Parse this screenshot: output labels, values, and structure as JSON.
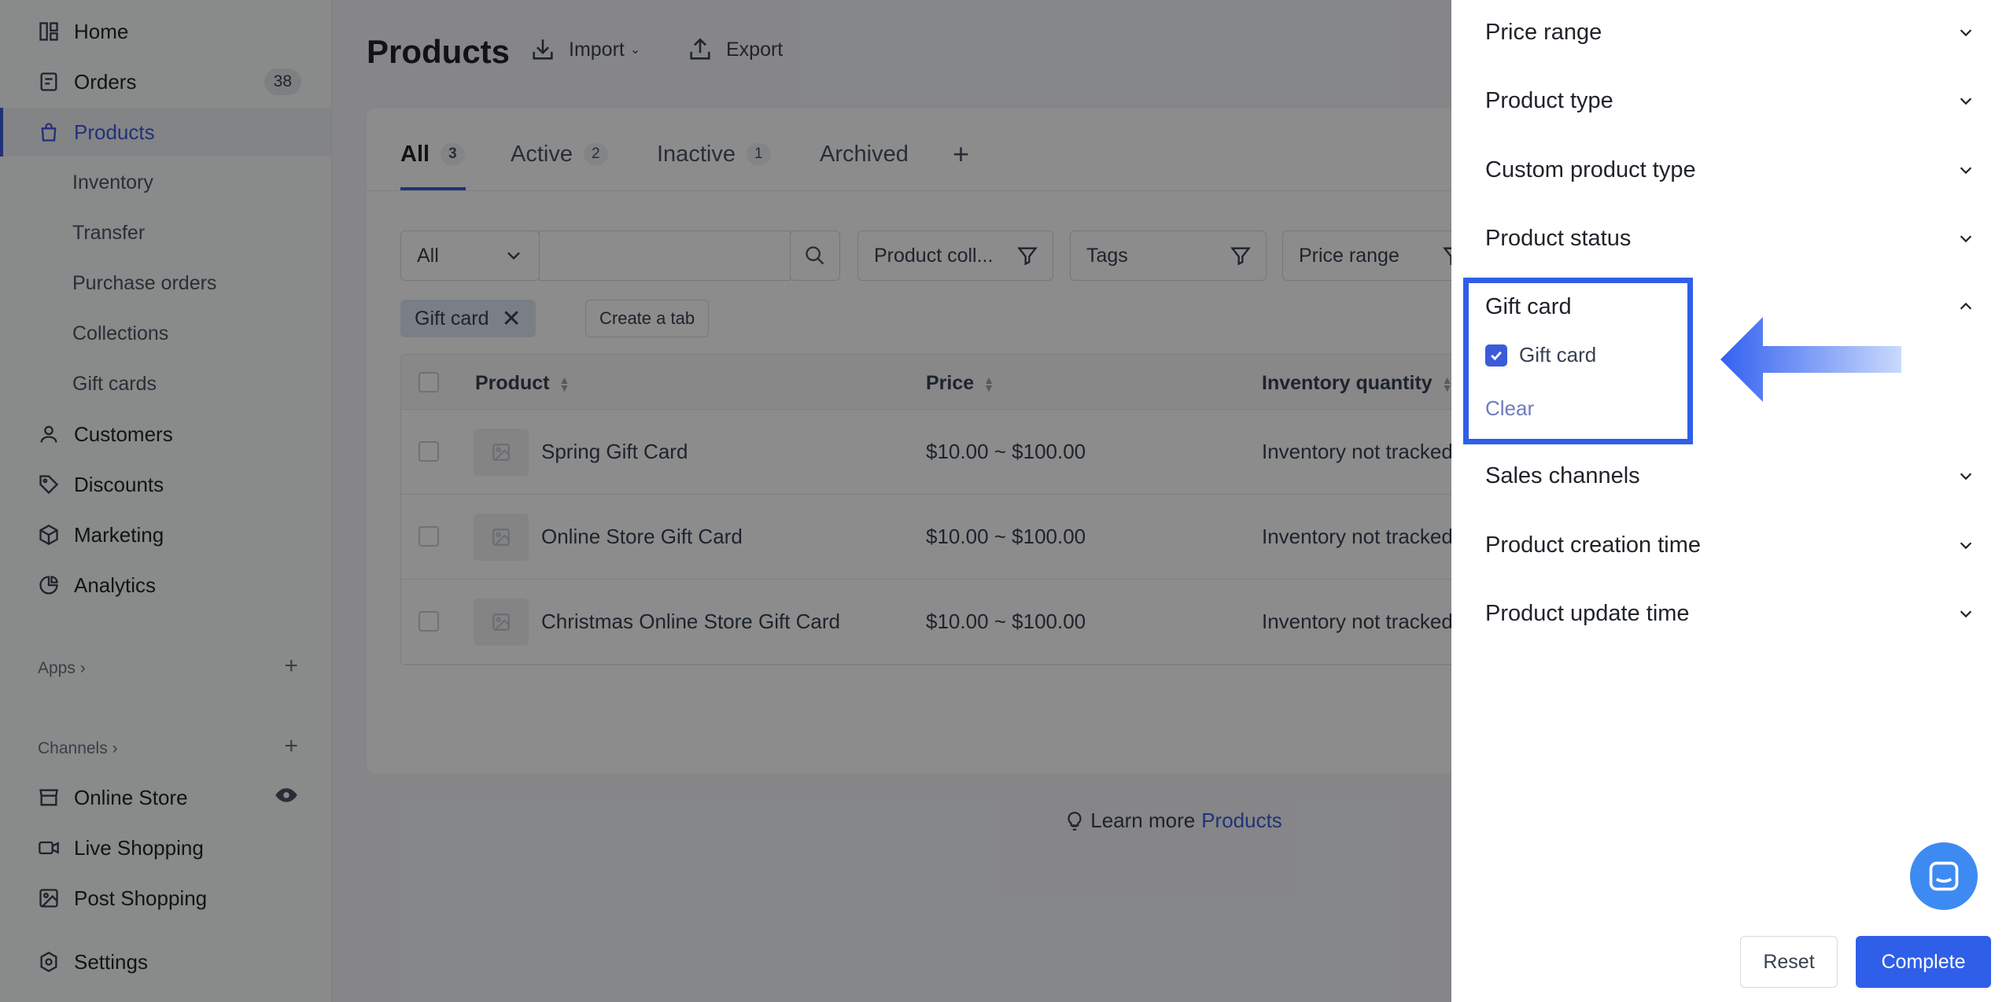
{
  "sidebar": {
    "items": [
      {
        "label": "Home",
        "icon": "home-icon"
      },
      {
        "label": "Orders",
        "icon": "orders-icon",
        "badge": "38"
      },
      {
        "label": "Products",
        "icon": "bag-icon",
        "active": true
      },
      {
        "label": "Customers",
        "icon": "person-icon"
      },
      {
        "label": "Discounts",
        "icon": "tag-icon"
      },
      {
        "label": "Marketing",
        "icon": "cube-icon"
      },
      {
        "label": "Analytics",
        "icon": "pie-icon"
      }
    ],
    "subitems": [
      "Inventory",
      "Transfer",
      "Purchase orders",
      "Collections",
      "Gift cards"
    ],
    "apps_label": "Apps",
    "channels_label": "Channels",
    "channels": [
      {
        "label": "Online Store",
        "icon": "store-icon"
      },
      {
        "label": "Live Shopping",
        "icon": "video-icon"
      },
      {
        "label": "Post Shopping",
        "icon": "image-icon"
      }
    ],
    "settings_label": "Settings"
  },
  "header": {
    "title": "Products",
    "import_label": "Import",
    "export_label": "Export"
  },
  "tabs": [
    {
      "label": "All",
      "count": "3"
    },
    {
      "label": "Active",
      "count": "2"
    },
    {
      "label": "Inactive",
      "count": "1"
    },
    {
      "label": "Archived"
    }
  ],
  "filters": {
    "select_value": "All",
    "search_value": "",
    "product_collection": "Product coll...",
    "tags": "Tags",
    "price_range": "Price range"
  },
  "chip": {
    "label": "Gift card"
  },
  "create_tab_label": "Create a tab",
  "table": {
    "columns": [
      "Product",
      "Price",
      "Inventory quantity"
    ],
    "rows": [
      {
        "product": "Spring Gift Card",
        "price": "$10.00 ~ $100.00",
        "inventory": "Inventory not tracked"
      },
      {
        "product": "Online Store Gift Card",
        "price": "$10.00 ~ $100.00",
        "inventory": "Inventory not tracked"
      },
      {
        "product": "Christmas Online Store Gift Card",
        "price": "$10.00 ~ $100.00",
        "inventory": "Inventory not tracked"
      }
    ]
  },
  "learn_more": {
    "prefix": "Learn more",
    "link": "Products"
  },
  "panel": {
    "sections": [
      "Price range",
      "Product type",
      "Custom product type",
      "Product status",
      "Gift card",
      "Sales channels",
      "Product creation time",
      "Product update time"
    ],
    "gift_card_option": "Gift card",
    "gift_card_checked": true,
    "clear_label": "Clear",
    "reset_label": "Reset",
    "complete_label": "Complete"
  },
  "colors": {
    "accent": "#3b5bdb",
    "highlight": "#2f5fe8"
  }
}
